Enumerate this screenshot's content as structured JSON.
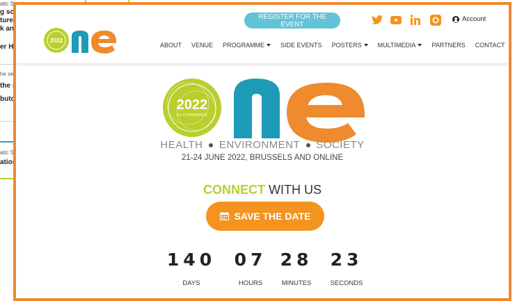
{
  "background_page": {
    "lines": [
      "atic Session",
      "g sc",
      "ture",
      "k ana",
      "er Ha",
      "he se",
      "the s",
      "butc",
      "atic S",
      "ation"
    ]
  },
  "header": {
    "logo_small_text": "2022",
    "register_label": "REGISTER FOR THE EVENT",
    "social_icons": [
      "twitter-icon",
      "youtube-icon",
      "linkedin-icon",
      "instagram-icon"
    ],
    "account_label": "Account",
    "nav": [
      {
        "label": "ABOUT",
        "dropdown": false
      },
      {
        "label": "VENUE",
        "dropdown": false
      },
      {
        "label": "PROGRAMME",
        "dropdown": true
      },
      {
        "label": "SIDE EVENTS",
        "dropdown": false
      },
      {
        "label": "POSTERS",
        "dropdown": true
      },
      {
        "label": "MULTIMEDIA",
        "dropdown": true
      },
      {
        "label": "PARTNERS",
        "dropdown": false
      },
      {
        "label": "CONTACT",
        "dropdown": false
      }
    ]
  },
  "hero": {
    "year": "2022",
    "conference_label": "EU CONFERENCE",
    "tagline_words": [
      "HEALTH",
      "ENVIRONMENT",
      "SOCIETY"
    ],
    "dates": "21-24 JUNE 2022, BRUSSELS AND ONLINE",
    "connect_highlight": "CONNECT",
    "connect_rest": " WITH US",
    "save_label": "SAVE THE DATE"
  },
  "countdown": [
    {
      "value": "140",
      "label": "DAYS"
    },
    {
      "value": "07",
      "label": "HOURS"
    },
    {
      "value": "28",
      "label": "MINUTES"
    },
    {
      "value": "23",
      "label": "SECONDS"
    }
  ],
  "colors": {
    "accent_orange": "#ef8a2e",
    "lime": "#b9cf2d",
    "teal": "#1d9bb7",
    "register_blue": "#62c3d7",
    "save_orange": "#f39421"
  }
}
